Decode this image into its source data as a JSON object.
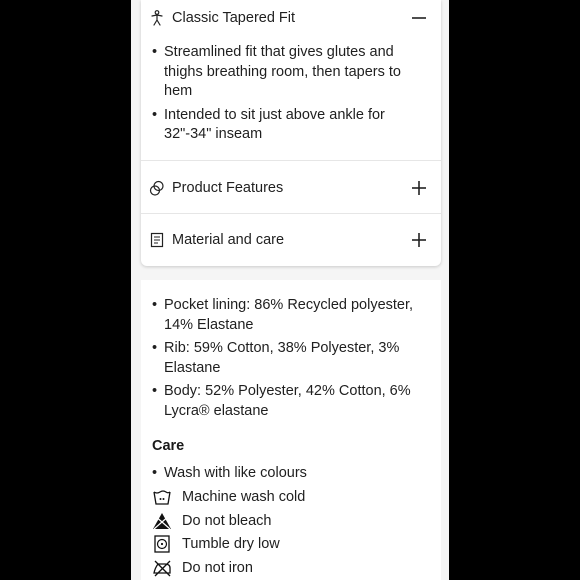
{
  "fit": {
    "title": "Classic Tapered Fit",
    "icon": "person-icon",
    "bullets": [
      "Streamlined fit that gives glutes and thighs breathing room, then tapers to hem",
      "Intended to sit just above ankle for 32\"-34\" inseam"
    ]
  },
  "features": {
    "title": "Product Features",
    "icon": "features-icon"
  },
  "material": {
    "title": "Material and care",
    "icon": "document-icon"
  },
  "materials_list": [
    "Pocket lining: 86% Recycled polyester, 14% Elastane",
    "Rib: 59% Cotton, 38% Polyester, 3% Elastane",
    "Body: 52% Polyester, 42% Cotton, 6% Lycra® elastane"
  ],
  "care": {
    "title": "Care",
    "first": "Wash with like colours",
    "items": [
      {
        "icon": "machine-wash-cold-icon",
        "label": "Machine wash cold"
      },
      {
        "icon": "do-not-bleach-icon",
        "label": "Do not bleach"
      },
      {
        "icon": "tumble-dry-low-icon",
        "label": "Tumble dry low"
      },
      {
        "icon": "do-not-iron-icon",
        "label": "Do not iron"
      }
    ]
  }
}
